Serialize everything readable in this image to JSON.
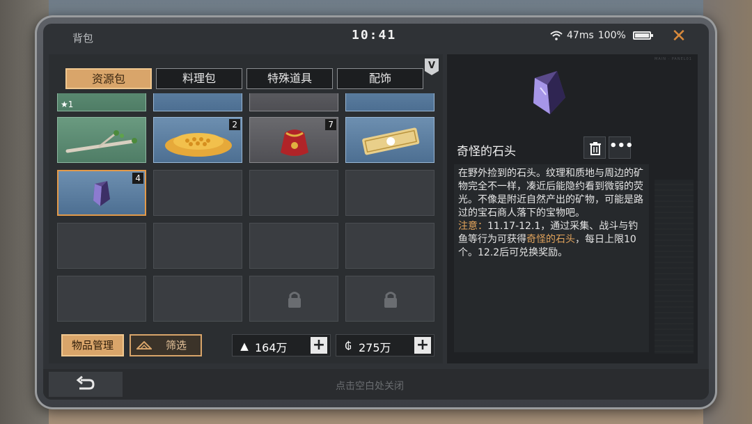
{
  "status": {
    "title": "背包",
    "time": "10:41",
    "ping": "47ms",
    "battery": "100%"
  },
  "tabs": [
    {
      "label": "资源包",
      "active": true
    },
    {
      "label": "料理包",
      "active": false
    },
    {
      "label": "特殊道具",
      "active": false
    },
    {
      "label": "配饰",
      "active": false
    }
  ],
  "badge": "V",
  "slots": {
    "row0_count": "★1",
    "row1": [
      {
        "icon": "branch-icon",
        "count": ""
      },
      {
        "icon": "honeycomb-icon",
        "count": "2"
      },
      {
        "icon": "red-pouch-icon",
        "count": "7"
      },
      {
        "icon": "ticket-icon",
        "count": ""
      }
    ],
    "selected": {
      "icon": "strange-stone-icon",
      "count": "4"
    }
  },
  "buttons": {
    "manage": "物品管理",
    "filter": "筛选"
  },
  "currency": {
    "silver": "164万",
    "gold": "275万"
  },
  "detail": {
    "name": "奇怪的石头",
    "desc_main": "在野外捡到的石头。纹理和质地与周边的矿物完全不一样，凑近后能隐约看到微弱的荧光。不像是附近自然产出的矿物，可能是路过的宝石商人落下的宝物吧。",
    "note_label": "注意：",
    "note_a": "11.17-12.1，通过采集、战斗与钓鱼等行为可获得",
    "note_hl": "奇怪的石头",
    "note_b": "，每日上限10个。12.2后可兑换奖励。",
    "deco": "MAIN · PANEL01"
  },
  "footer": {
    "hint": "点击空白处关闭"
  },
  "colors": {
    "accent": "#d9a56a",
    "highlight": "#e3a45c",
    "selected_border": "#e39a4a"
  }
}
